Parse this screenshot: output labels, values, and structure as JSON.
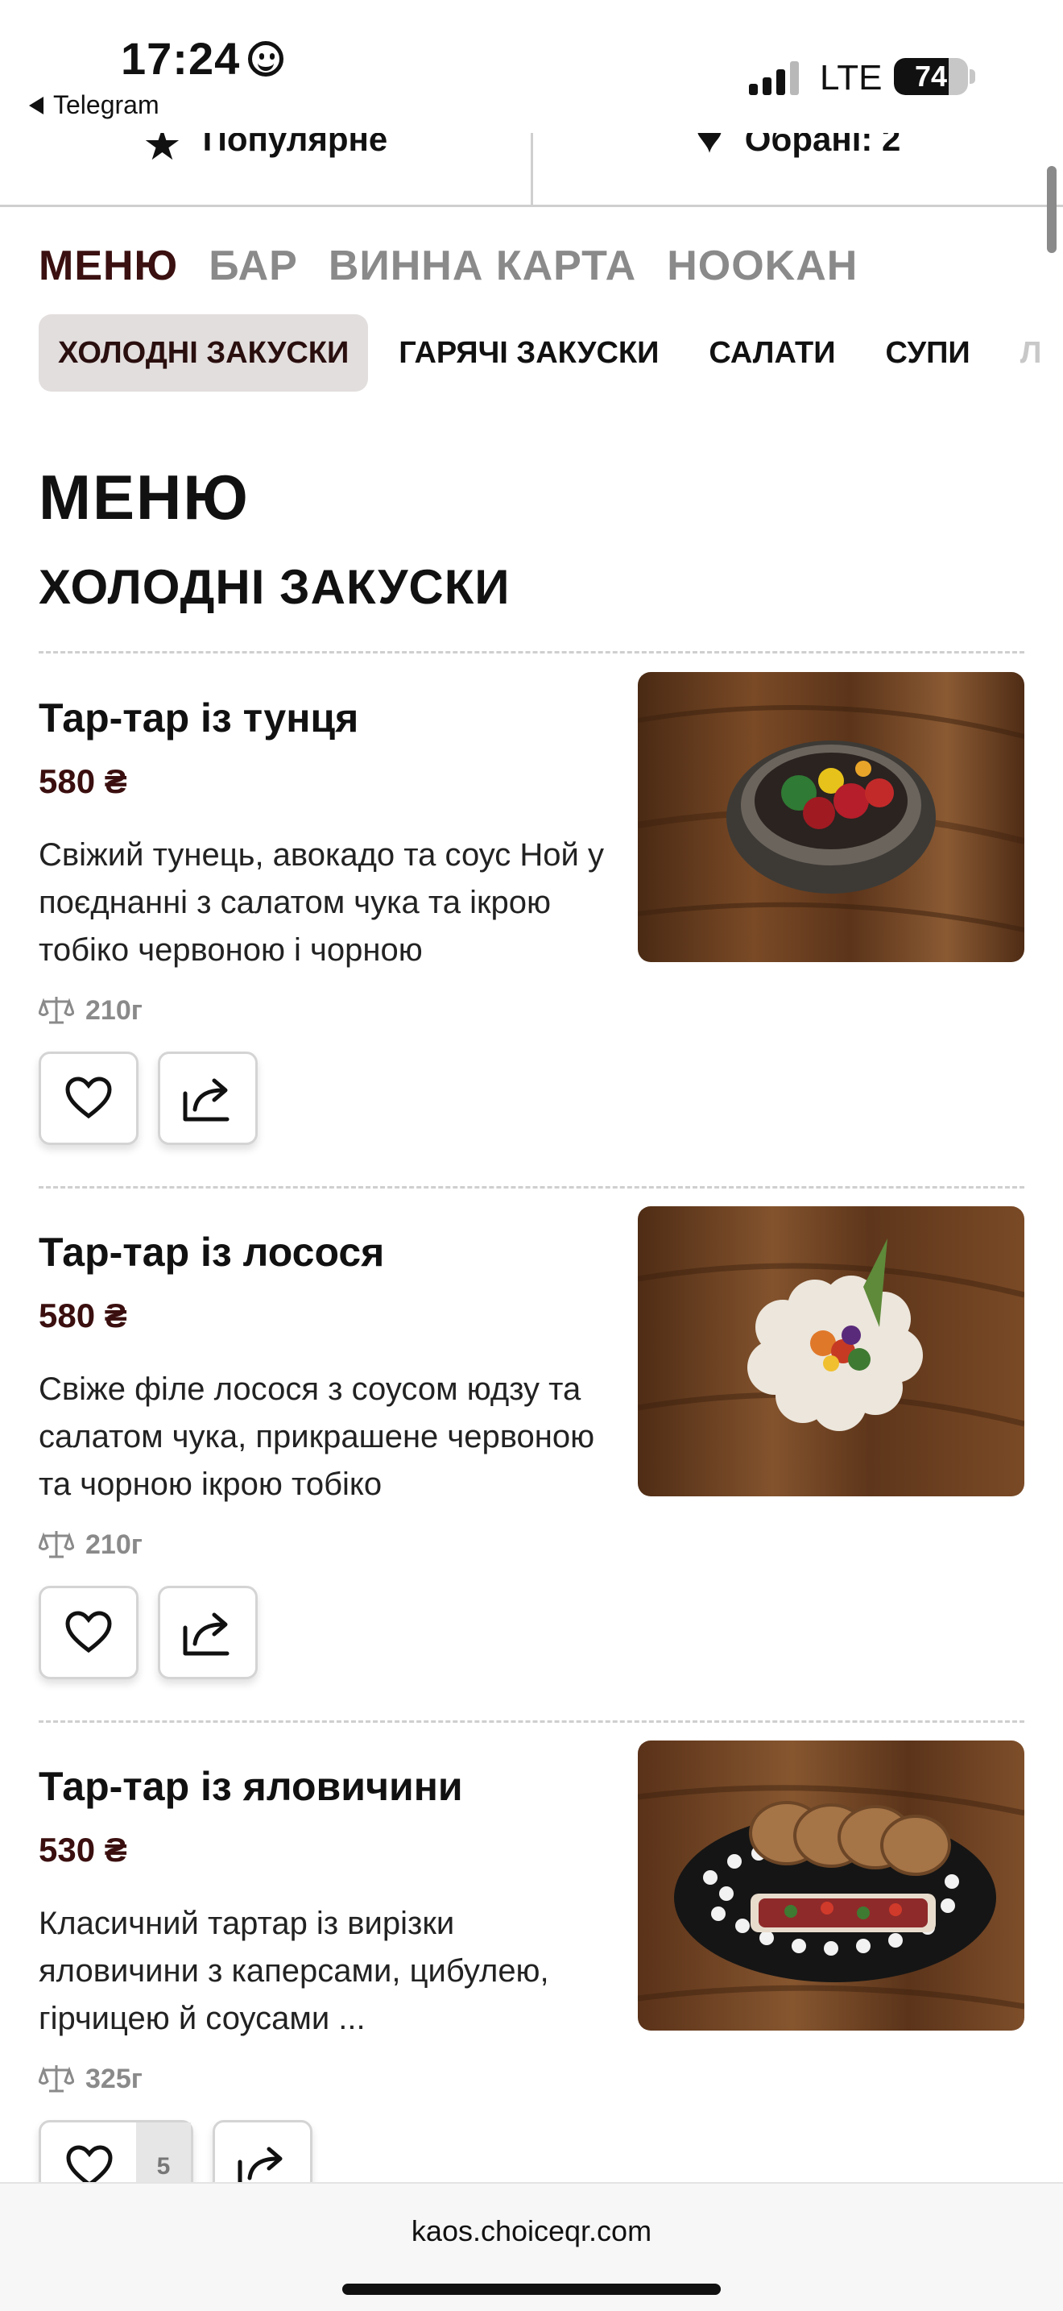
{
  "status_bar": {
    "time": "17:24",
    "back_app": "Telegram",
    "network": "LTE",
    "battery": "74",
    "battery_level": 0.74
  },
  "tool_row": {
    "popular_label": "Популярне",
    "favorites_label": "Обрані: 2"
  },
  "section_nav": [
    "МЕНЮ",
    "БАР",
    "ВИННА КАРТА",
    "HOOKAH"
  ],
  "category_tabs": [
    "ХОЛОДНІ ЗАКУСКИ",
    "ГАРЯЧІ ЗАКУСКИ",
    "САЛАТИ",
    "СУПИ",
    "Л"
  ],
  "page_title": "МЕНЮ",
  "section_title": "ХОЛОДНІ ЗАКУСКИ",
  "items": [
    {
      "name": "Тар-тар із тунця",
      "price": "580 ₴",
      "description": "Свіжий тунець, авокадо та соус Ной у поєднанні з салатом чука та ікрою тобіко червоною і чорною",
      "weight": "210г"
    },
    {
      "name": "Тар-тар із лосося",
      "price": "580 ₴",
      "description": "Свіже філе лосося з соусом юдзу та салатом чука, прикрашене червоною та чорною ікрою тобіко",
      "weight": "210г"
    },
    {
      "name": "Тар-тар із яловичини",
      "price": "530 ₴",
      "description": "Класичний тартар із вирізки яловичини з каперсами, цибулею, гірчицею й соусами ...",
      "weight": "325г",
      "likes": "5"
    }
  ],
  "browser": {
    "url": "kaos.choiceqr.com"
  },
  "colors": {
    "accent": "#3b1010",
    "active_tab_bg": "#e2dedd",
    "muted": "#8a8a8a"
  }
}
